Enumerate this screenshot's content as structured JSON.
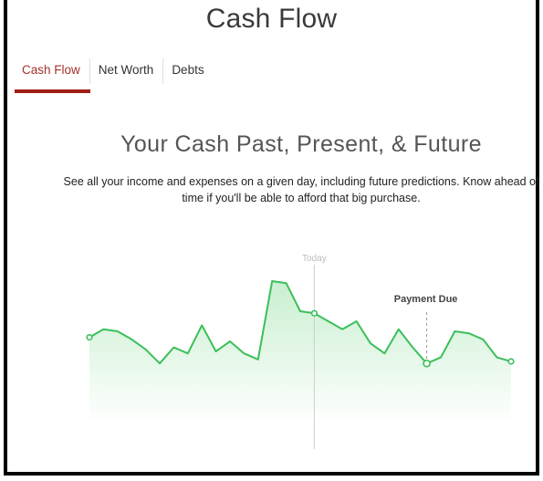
{
  "app": {
    "title": "Cash Flow"
  },
  "tabs": [
    {
      "label": "Cash Flow",
      "active": true
    },
    {
      "label": "Net Worth",
      "active": false
    },
    {
      "label": "Debts",
      "active": false
    }
  ],
  "hero": {
    "title": "Your Cash Past, Present, & Future",
    "description": "See all your income and expenses on a given day, including future predictions. Know ahead of time if you'll be able to afford that big purchase."
  },
  "colors": {
    "accent": "#a01e17",
    "line": "#3cbf5a",
    "fill_top": "#c9efd0",
    "fill_bottom": "#ffffff",
    "marker": "#cfcfcf"
  },
  "chart_data": {
    "type": "area",
    "today_label": "Today",
    "payment_label": "Payment Due",
    "today_index": 16,
    "payment_index": 24,
    "highlight_indices": [
      0,
      16,
      24,
      30
    ],
    "values": [
      72,
      76,
      75,
      71,
      66,
      59,
      67,
      64,
      78,
      65,
      70,
      64,
      61,
      100,
      99,
      85,
      84,
      80,
      76,
      80,
      69,
      64,
      76,
      67,
      59,
      62,
      75,
      74,
      71,
      62,
      60
    ]
  }
}
